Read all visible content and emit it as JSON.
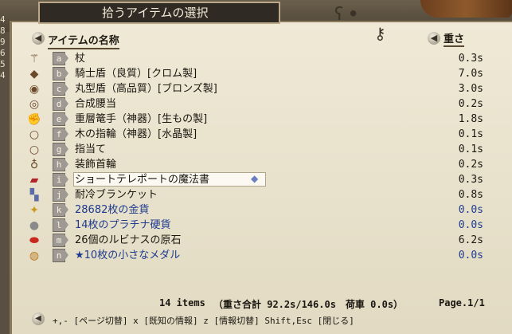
{
  "window": {
    "title": "拾うアイテムの選択"
  },
  "left_strip": [
    "4",
    "8",
    "9",
    "6",
    "5",
    "4"
  ],
  "header": {
    "name_label": "アイテムの名称",
    "weight_label": "重さ"
  },
  "items": [
    {
      "letter": "a",
      "name": "杖",
      "weight": "0.3s",
      "icon": "staff-icon",
      "glyph": "⚚"
    },
    {
      "letter": "b",
      "name": "騎士盾（良質）[クロム製]",
      "weight": "7.0s",
      "icon": "shield-icon",
      "glyph": "◆"
    },
    {
      "letter": "c",
      "name": "丸型盾（高品質）[ブロンズ製]",
      "weight": "3.0s",
      "icon": "round-shield-icon",
      "glyph": "◉"
    },
    {
      "letter": "d",
      "name": "合成腰当",
      "weight": "0.2s",
      "icon": "belt-icon",
      "glyph": "◎"
    },
    {
      "letter": "e",
      "name": "重層篭手（神器）[生もの製]",
      "weight": "1.8s",
      "icon": "gauntlet-icon",
      "glyph": "✊"
    },
    {
      "letter": "f",
      "name": "木の指輪（神器）[水晶製]",
      "weight": "0.1s",
      "icon": "ring-icon",
      "glyph": "○"
    },
    {
      "letter": "g",
      "name": "指当て",
      "weight": "0.1s",
      "icon": "ring-icon",
      "glyph": "○"
    },
    {
      "letter": "h",
      "name": "装飾首輪",
      "weight": "0.2s",
      "icon": "necklace-icon",
      "glyph": "♁"
    },
    {
      "letter": "i",
      "name": "ショートテレポートの魔法書",
      "weight": "0.3s",
      "icon": "spellbook-icon",
      "glyph": "▰"
    },
    {
      "letter": "j",
      "name": "耐冷ブランケット",
      "weight": "0.8s",
      "icon": "blanket-icon",
      "glyph": "▚"
    },
    {
      "letter": "k",
      "name": "28682枚の金貨",
      "weight": "0.0s",
      "icon": "gold-coin-icon",
      "glyph": "✦"
    },
    {
      "letter": "l",
      "name": "14枚のプラチナ硬貨",
      "weight": "0.0s",
      "icon": "platinum-coin-icon",
      "glyph": "●"
    },
    {
      "letter": "m",
      "name": "26個のルビナスの原石",
      "weight": "6.2s",
      "icon": "ore-icon",
      "glyph": "⬬"
    },
    {
      "letter": "n",
      "name": "★10枚の小さなメダル",
      "weight": "0.0s",
      "icon": "medal-icon",
      "glyph": "◍"
    }
  ],
  "footer": {
    "items_count": "14 items",
    "weight_total": "（重さ合計 92.2s/146.0s　荷車 0.0s）",
    "page": "Page.1/1"
  },
  "help_text": "+,- [ページ切替]  x [既知の情報]  z [情報切替]  Shift,Esc [閉じる]",
  "colors": {
    "panel": "#efe9d6",
    "text": "#1a1610",
    "blue_item": "#1d3a8f",
    "title_bg": "#2f2a24"
  }
}
